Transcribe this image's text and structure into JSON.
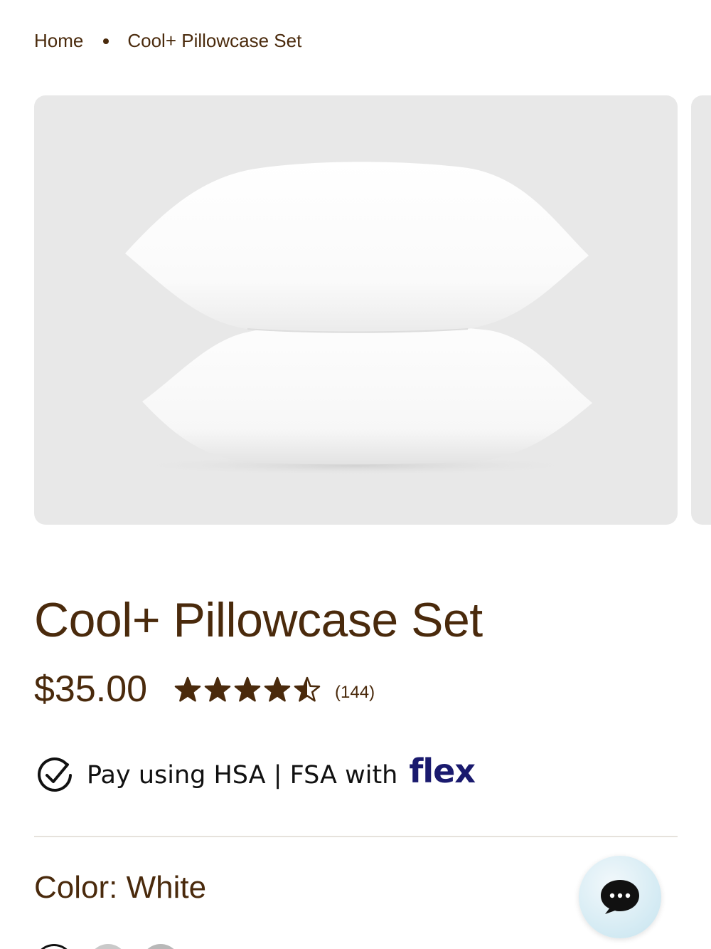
{
  "breadcrumb": {
    "home": "Home",
    "current": "Cool+ Pillowcase Set"
  },
  "product": {
    "title": "Cool+ Pillowcase Set",
    "price": "$35.00",
    "rating": 4.5,
    "rating_max": 5,
    "review_count": "(144)"
  },
  "payment": {
    "text": "Pay using HSA | FSA with",
    "logo_text": "flex",
    "icon": "check-circle-icon"
  },
  "color": {
    "label": "Color: White"
  },
  "chat": {
    "icon": "chat-bubble-icon"
  },
  "colors": {
    "text": "#4a2a0c",
    "image_bg": "#e8e8e8",
    "flex_brand": "#1a1a6e",
    "chat_bg": "#d7ecf4"
  }
}
